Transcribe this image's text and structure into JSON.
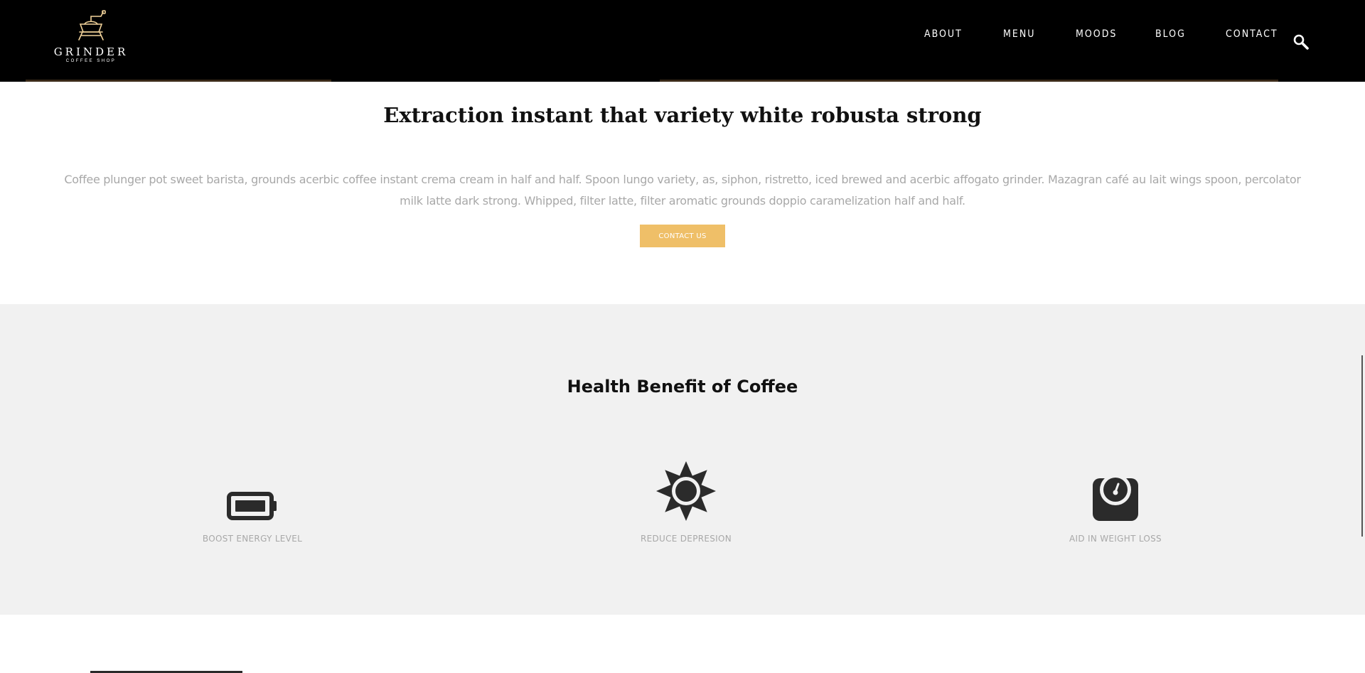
{
  "header": {
    "logo": {
      "name": "GRINDER",
      "tagline": "COFFEE SHOP"
    },
    "nav": [
      {
        "label": "ABOUT"
      },
      {
        "label": "MENU"
      },
      {
        "label": "MOODS"
      },
      {
        "label": "BLOG"
      },
      {
        "label": "CONTACT"
      }
    ],
    "search_icon": "search-icon"
  },
  "intro": {
    "title": "Extraction instant that variety white robusta strong",
    "text": "Coffee plunger pot sweet barista, grounds acerbic coffee instant crema cream in half and half. Spoon lungo variety, as, siphon, ristretto, iced brewed and acerbic affogato grinder. Mazagran café au lait wings spoon, percolator milk latte dark strong. Whipped, filter latte, filter aromatic grounds doppio caramelization half and half.",
    "button_label": "CONTACT US",
    "button_color": "#efbf68"
  },
  "health": {
    "title": "Health Benefit of Coffee",
    "benefits": [
      {
        "label": "BOOST ENERGY LEVEL",
        "icon": "battery-icon"
      },
      {
        "label": "REDUCE DEPRESION",
        "icon": "sun-icon"
      },
      {
        "label": "AID IN WEIGHT LOSS",
        "icon": "scale-icon"
      }
    ],
    "background": "#f1f1f1"
  }
}
